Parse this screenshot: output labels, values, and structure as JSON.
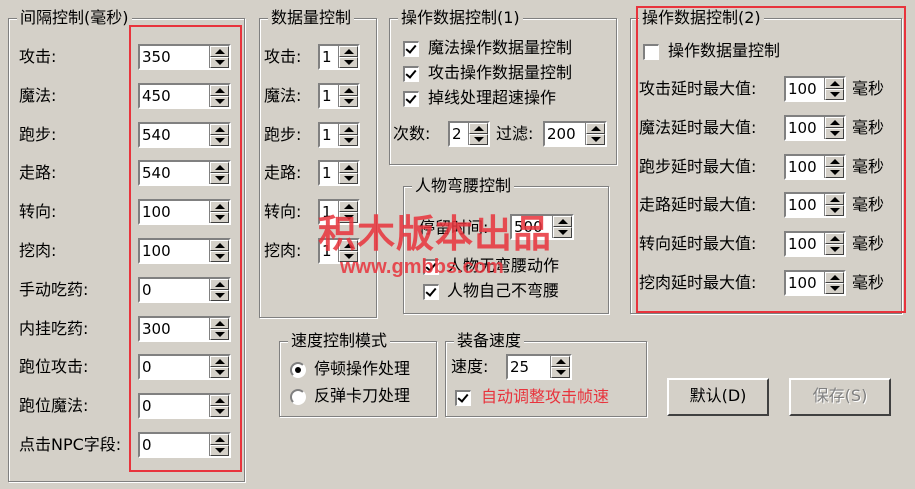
{
  "interval": {
    "title": "间隔控制(毫秒)",
    "rows": [
      {
        "label": "攻击:",
        "value": "350"
      },
      {
        "label": "魔法:",
        "value": "450"
      },
      {
        "label": "跑步:",
        "value": "540"
      },
      {
        "label": "走路:",
        "value": "540"
      },
      {
        "label": "转向:",
        "value": "100"
      },
      {
        "label": "挖肉:",
        "value": "100"
      },
      {
        "label": "手动吃药:",
        "value": "0"
      },
      {
        "label": "内挂吃药:",
        "value": "300"
      },
      {
        "label": "跑位攻击:",
        "value": "0"
      },
      {
        "label": "跑位魔法:",
        "value": "0"
      },
      {
        "label": "点击NPC字段:",
        "value": "0"
      }
    ]
  },
  "quantity": {
    "title": "数据量控制",
    "rows": [
      {
        "label": "攻击:",
        "value": "1"
      },
      {
        "label": "魔法:",
        "value": "1"
      },
      {
        "label": "跑步:",
        "value": "1"
      },
      {
        "label": "走路:",
        "value": "1"
      },
      {
        "label": "转向:",
        "value": "1"
      },
      {
        "label": "挖肉:",
        "value": "1"
      }
    ]
  },
  "op1": {
    "title": "操作数据控制(1)",
    "checks": [
      {
        "label": "魔法操作数据量控制",
        "checked": true
      },
      {
        "label": "攻击操作数据量控制",
        "checked": true
      },
      {
        "label": "掉线处理超速操作",
        "checked": true
      }
    ],
    "count_label": "次数:",
    "count_value": "2",
    "filter_label": "过滤:",
    "filter_value": "200"
  },
  "bow": {
    "title": "人物弯腰控制",
    "stay_label": "停留时间:",
    "stay_value": "500",
    "checks": [
      {
        "label": "人物无弯腰动作",
        "checked": true
      },
      {
        "label": "人物自己不弯腰",
        "checked": true
      }
    ]
  },
  "op2": {
    "title": "操作数据控制(2)",
    "check_label": "操作数据量控制",
    "unit": "毫秒",
    "rows": [
      {
        "label": "攻击延时最大值:",
        "value": "100"
      },
      {
        "label": "魔法延时最大值:",
        "value": "100"
      },
      {
        "label": "跑步延时最大值:",
        "value": "100"
      },
      {
        "label": "走路延时最大值:",
        "value": "100"
      },
      {
        "label": "转向延时最大值:",
        "value": "100"
      },
      {
        "label": "挖肉延时最大值:",
        "value": "100"
      }
    ]
  },
  "speed_mode": {
    "title": "速度控制模式",
    "options": [
      {
        "label": "停顿操作处理",
        "selected": true
      },
      {
        "label": "反弹卡刀处理",
        "selected": false
      }
    ]
  },
  "equip": {
    "title": "装备速度",
    "speed_label": "速度:",
    "speed_value": "25",
    "auto_label": "自动调整攻击帧速",
    "auto_checked": true
  },
  "buttons": {
    "default": "默认(D)",
    "save": "保存(S)"
  },
  "watermark": {
    "line1": "积木版本出品",
    "line2": "www.gmbbs.com"
  },
  "colors": {
    "highlight_red": "#e8333c",
    "dialog_bg": "#d4d0c8"
  }
}
